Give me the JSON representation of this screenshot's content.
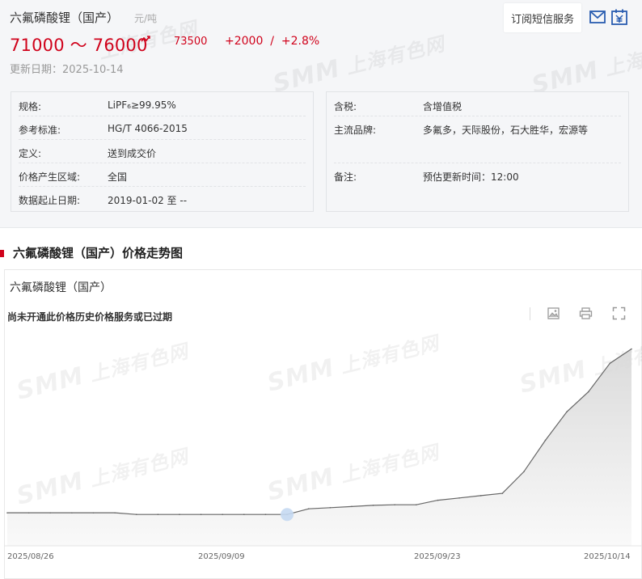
{
  "header": {
    "title": "六氟磷酸锂（国产）",
    "unit": "元/吨",
    "subscribe_label": "订阅短信服务",
    "mail_icon": "mail-icon",
    "calendar_icon": "calendar-icon"
  },
  "price": {
    "range": "71000 ～ 76000",
    "average": "73500",
    "change": "+2000  /  +2.8%",
    "trend_icon": "up-trend-icon",
    "update_date": "更新日期：2025-10-14",
    "color": "#d0021b"
  },
  "info_left": [
    {
      "key": "规格:",
      "value": "LiPF₆≥99.95%"
    },
    {
      "key": "参考标准:",
      "value": "HG/T 4066-2015"
    },
    {
      "key": "定义:",
      "value": "送到成交价"
    },
    {
      "key": "价格产生区域:",
      "value": "全国"
    },
    {
      "key": "数据起止日期:",
      "value": "2019-01-02 至 --"
    }
  ],
  "info_right": [
    {
      "key": "含税:",
      "value": "含增值税"
    },
    {
      "key": "主流品牌:",
      "value": "多氟多，天际股份，石大胜华，宏源等"
    },
    {
      "key": "备注:",
      "value": "预估更新时间：12:00"
    }
  ],
  "section": {
    "title": "六氟磷酸锂（国产）价格走势图"
  },
  "chart": {
    "name": "六氟磷酸锂（国产）",
    "notice": "尚未开通此价格历史价格服务或已过期",
    "tools": [
      "image-download-icon",
      "print-icon",
      "fullscreen-icon"
    ]
  },
  "watermark": {
    "latin": "SMM",
    "cn": "上海有色网"
  },
  "chart_data": {
    "type": "area",
    "x": [
      "2025-08-26",
      "2025-08-27",
      "2025-08-28",
      "2025-08-29",
      "2025-09-01",
      "2025-09-02",
      "2025-09-03",
      "2025-09-04",
      "2025-09-05",
      "2025-09-08",
      "2025-09-09",
      "2025-09-10",
      "2025-09-11",
      "2025-09-12",
      "2025-09-15",
      "2025-09-16",
      "2025-09-17",
      "2025-09-18",
      "2025-09-19",
      "2025-09-22",
      "2025-09-23",
      "2025-09-24",
      "2025-09-25",
      "2025-09-26",
      "2025-09-29",
      "2025-09-30",
      "2025-10-09",
      "2025-10-10",
      "2025-10-13",
      "2025-10-14"
    ],
    "values": [
      50800,
      50800,
      50800,
      50800,
      50800,
      50800,
      50500,
      50500,
      50500,
      50500,
      50500,
      50500,
      50500,
      50500,
      51500,
      51700,
      51900,
      52100,
      52200,
      52200,
      53000,
      53400,
      53800,
      54200,
      58000,
      63500,
      68500,
      72000,
      77000,
      79500
    ],
    "xticks": [
      "2025/08/26",
      "2025/09/09",
      "2025/09/23",
      "2025/10/14"
    ],
    "highlight_index": 13,
    "line_color": "#666666",
    "fill_color": "#d9d9d9",
    "highlight_color": "#c5d9f2"
  }
}
